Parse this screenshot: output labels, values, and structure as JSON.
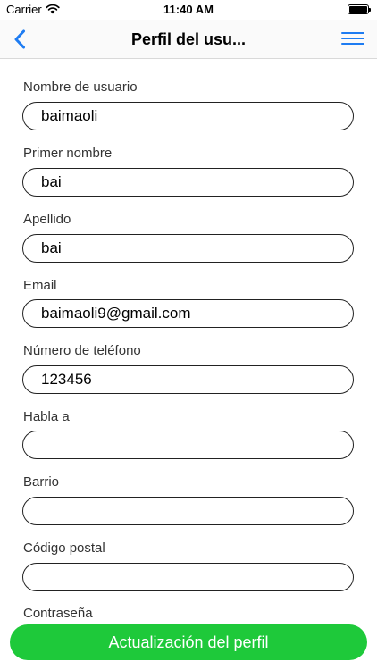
{
  "status_bar": {
    "carrier": "Carrier",
    "time": "11:40 AM"
  },
  "nav": {
    "title": "Perfil del usu...",
    "accent_color": "#1e7cf2"
  },
  "form": {
    "fields": [
      {
        "label": "Nombre de usuario",
        "value": "baimaoli"
      },
      {
        "label": "Primer nombre",
        "value": "bai"
      },
      {
        "label": "Apellido",
        "value": "bai"
      },
      {
        "label": "Email",
        "value": "baimaoli9@gmail.com"
      },
      {
        "label": "Número de teléfono",
        "value": "123456"
      },
      {
        "label": "Habla a",
        "value": ""
      },
      {
        "label": "Barrio",
        "value": ""
      },
      {
        "label": "Código postal",
        "value": ""
      },
      {
        "label": "Contraseña",
        "value": ""
      }
    ]
  },
  "actions": {
    "update_label": "Actualización del perfil",
    "button_color": "#1ec93a"
  }
}
